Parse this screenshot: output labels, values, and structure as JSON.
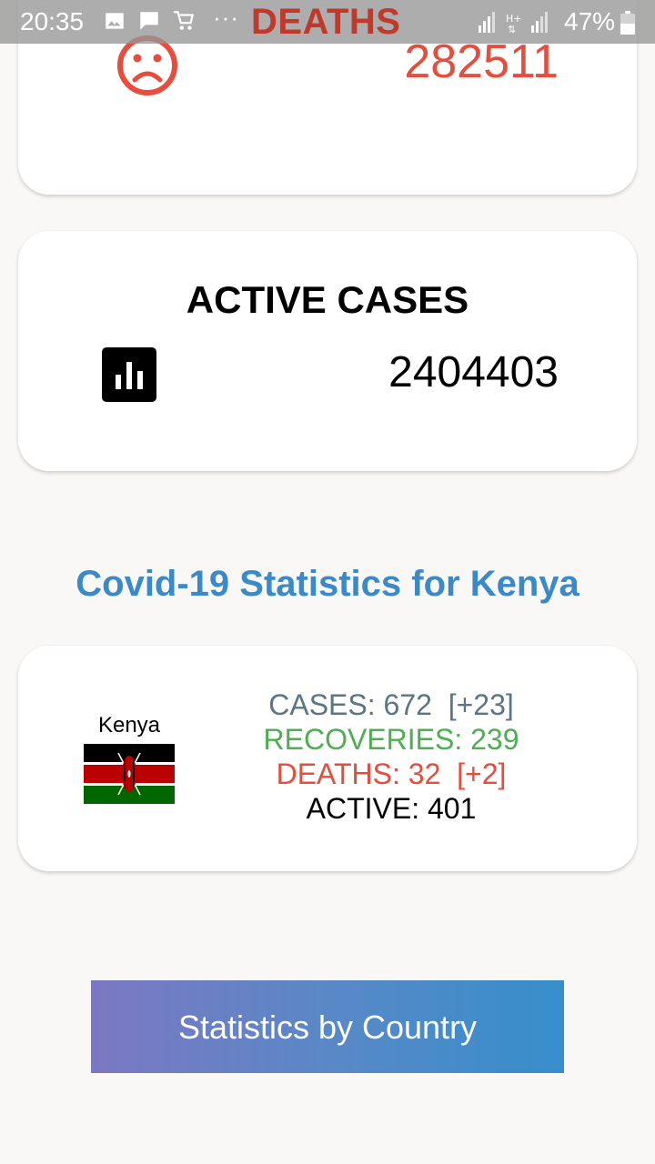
{
  "status_bar": {
    "time": "20:35",
    "dots": "···",
    "overlay_title": "DEATHS",
    "battery": "47%"
  },
  "deaths_card": {
    "value": "282511",
    "icon": "sad-face-icon",
    "color": "#e74c3c"
  },
  "active_card": {
    "title": "ACTIVE CASES",
    "value": "2404403",
    "icon": "bar-chart-icon"
  },
  "section": {
    "title": "Covid-19 Statistics for Kenya",
    "color": "#3a8ac9"
  },
  "country_card": {
    "name": "Kenya",
    "flag": "kenya-flag",
    "cases": "CASES: 672  [+23]",
    "recoveries": "RECOVERIES: 239",
    "deaths": "DEATHS: 32  [+2]",
    "active": "ACTIVE: 401"
  },
  "button": {
    "label": "Statistics by Country"
  }
}
